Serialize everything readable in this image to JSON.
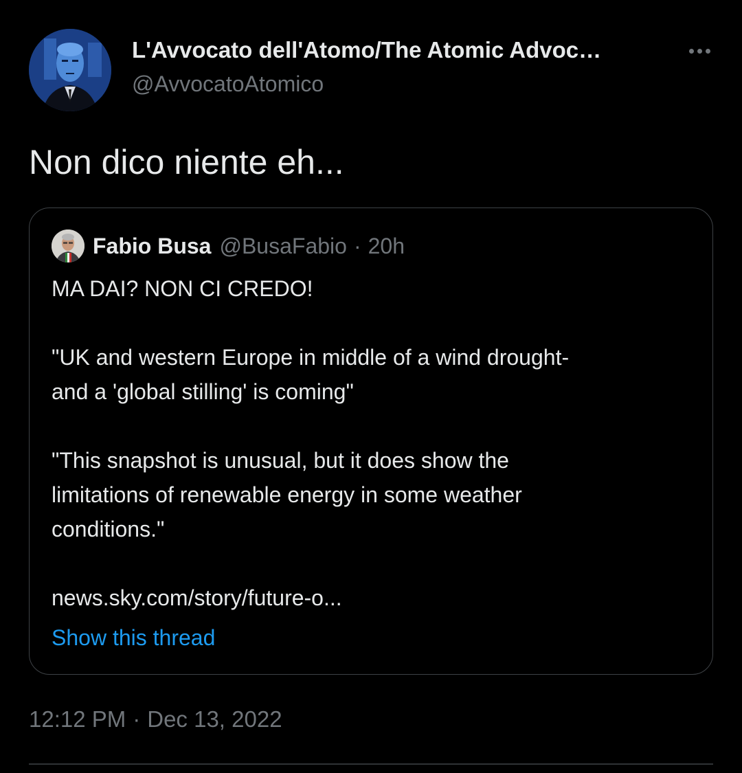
{
  "tweet": {
    "author": {
      "display_name": "L'Avvocato dell'Atomo/The Atomic Advoc…",
      "handle": "@AvvocatoAtomico"
    },
    "text": "Non dico niente eh...",
    "quoted_tweet": {
      "author_name": "Fabio Busa",
      "author_handle": "@BusaFabio",
      "separator": "·",
      "time_ago": "20h",
      "paragraphs": [
        "MA DAI? NON CI CREDO!",
        "\"UK and western Europe in middle of a wind drought-\nand a 'global stilling' is coming\"",
        "\"This snapshot is unusual, but it does show the\nlimitations of renewable energy in some weather\nconditions.\"",
        "news.sky.com/story/future-o..."
      ],
      "show_thread_label": "Show this thread"
    },
    "timestamp": {
      "time": "12:12 PM",
      "separator": "·",
      "date": "Dec 13, 2022"
    }
  },
  "icons": {
    "more": "more-horizontal-icon"
  },
  "colors": {
    "background": "#000000",
    "primary_text": "#e7e9ea",
    "secondary_text": "#71767b",
    "link": "#1d9bf0",
    "border": "#3e4246"
  }
}
